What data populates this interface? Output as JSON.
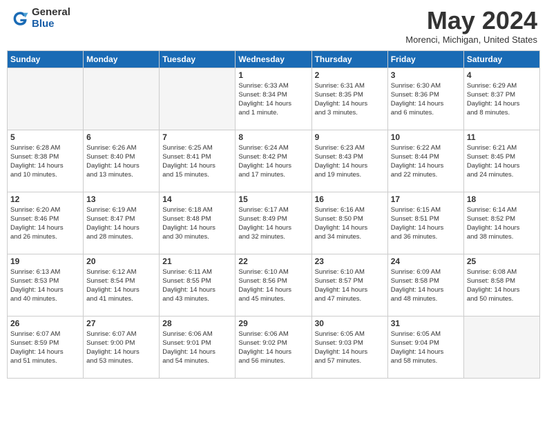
{
  "logo": {
    "general": "General",
    "blue": "Blue"
  },
  "title": "May 2024",
  "location": "Morenci, Michigan, United States",
  "days_of_week": [
    "Sunday",
    "Monday",
    "Tuesday",
    "Wednesday",
    "Thursday",
    "Friday",
    "Saturday"
  ],
  "weeks": [
    [
      {
        "day": "",
        "info": ""
      },
      {
        "day": "",
        "info": ""
      },
      {
        "day": "",
        "info": ""
      },
      {
        "day": "1",
        "info": "Sunrise: 6:33 AM\nSunset: 8:34 PM\nDaylight: 14 hours\nand 1 minute."
      },
      {
        "day": "2",
        "info": "Sunrise: 6:31 AM\nSunset: 8:35 PM\nDaylight: 14 hours\nand 3 minutes."
      },
      {
        "day": "3",
        "info": "Sunrise: 6:30 AM\nSunset: 8:36 PM\nDaylight: 14 hours\nand 6 minutes."
      },
      {
        "day": "4",
        "info": "Sunrise: 6:29 AM\nSunset: 8:37 PM\nDaylight: 14 hours\nand 8 minutes."
      }
    ],
    [
      {
        "day": "5",
        "info": "Sunrise: 6:28 AM\nSunset: 8:38 PM\nDaylight: 14 hours\nand 10 minutes."
      },
      {
        "day": "6",
        "info": "Sunrise: 6:26 AM\nSunset: 8:40 PM\nDaylight: 14 hours\nand 13 minutes."
      },
      {
        "day": "7",
        "info": "Sunrise: 6:25 AM\nSunset: 8:41 PM\nDaylight: 14 hours\nand 15 minutes."
      },
      {
        "day": "8",
        "info": "Sunrise: 6:24 AM\nSunset: 8:42 PM\nDaylight: 14 hours\nand 17 minutes."
      },
      {
        "day": "9",
        "info": "Sunrise: 6:23 AM\nSunset: 8:43 PM\nDaylight: 14 hours\nand 19 minutes."
      },
      {
        "day": "10",
        "info": "Sunrise: 6:22 AM\nSunset: 8:44 PM\nDaylight: 14 hours\nand 22 minutes."
      },
      {
        "day": "11",
        "info": "Sunrise: 6:21 AM\nSunset: 8:45 PM\nDaylight: 14 hours\nand 24 minutes."
      }
    ],
    [
      {
        "day": "12",
        "info": "Sunrise: 6:20 AM\nSunset: 8:46 PM\nDaylight: 14 hours\nand 26 minutes."
      },
      {
        "day": "13",
        "info": "Sunrise: 6:19 AM\nSunset: 8:47 PM\nDaylight: 14 hours\nand 28 minutes."
      },
      {
        "day": "14",
        "info": "Sunrise: 6:18 AM\nSunset: 8:48 PM\nDaylight: 14 hours\nand 30 minutes."
      },
      {
        "day": "15",
        "info": "Sunrise: 6:17 AM\nSunset: 8:49 PM\nDaylight: 14 hours\nand 32 minutes."
      },
      {
        "day": "16",
        "info": "Sunrise: 6:16 AM\nSunset: 8:50 PM\nDaylight: 14 hours\nand 34 minutes."
      },
      {
        "day": "17",
        "info": "Sunrise: 6:15 AM\nSunset: 8:51 PM\nDaylight: 14 hours\nand 36 minutes."
      },
      {
        "day": "18",
        "info": "Sunrise: 6:14 AM\nSunset: 8:52 PM\nDaylight: 14 hours\nand 38 minutes."
      }
    ],
    [
      {
        "day": "19",
        "info": "Sunrise: 6:13 AM\nSunset: 8:53 PM\nDaylight: 14 hours\nand 40 minutes."
      },
      {
        "day": "20",
        "info": "Sunrise: 6:12 AM\nSunset: 8:54 PM\nDaylight: 14 hours\nand 41 minutes."
      },
      {
        "day": "21",
        "info": "Sunrise: 6:11 AM\nSunset: 8:55 PM\nDaylight: 14 hours\nand 43 minutes."
      },
      {
        "day": "22",
        "info": "Sunrise: 6:10 AM\nSunset: 8:56 PM\nDaylight: 14 hours\nand 45 minutes."
      },
      {
        "day": "23",
        "info": "Sunrise: 6:10 AM\nSunset: 8:57 PM\nDaylight: 14 hours\nand 47 minutes."
      },
      {
        "day": "24",
        "info": "Sunrise: 6:09 AM\nSunset: 8:58 PM\nDaylight: 14 hours\nand 48 minutes."
      },
      {
        "day": "25",
        "info": "Sunrise: 6:08 AM\nSunset: 8:58 PM\nDaylight: 14 hours\nand 50 minutes."
      }
    ],
    [
      {
        "day": "26",
        "info": "Sunrise: 6:07 AM\nSunset: 8:59 PM\nDaylight: 14 hours\nand 51 minutes."
      },
      {
        "day": "27",
        "info": "Sunrise: 6:07 AM\nSunset: 9:00 PM\nDaylight: 14 hours\nand 53 minutes."
      },
      {
        "day": "28",
        "info": "Sunrise: 6:06 AM\nSunset: 9:01 PM\nDaylight: 14 hours\nand 54 minutes."
      },
      {
        "day": "29",
        "info": "Sunrise: 6:06 AM\nSunset: 9:02 PM\nDaylight: 14 hours\nand 56 minutes."
      },
      {
        "day": "30",
        "info": "Sunrise: 6:05 AM\nSunset: 9:03 PM\nDaylight: 14 hours\nand 57 minutes."
      },
      {
        "day": "31",
        "info": "Sunrise: 6:05 AM\nSunset: 9:04 PM\nDaylight: 14 hours\nand 58 minutes."
      },
      {
        "day": "",
        "info": ""
      }
    ]
  ]
}
